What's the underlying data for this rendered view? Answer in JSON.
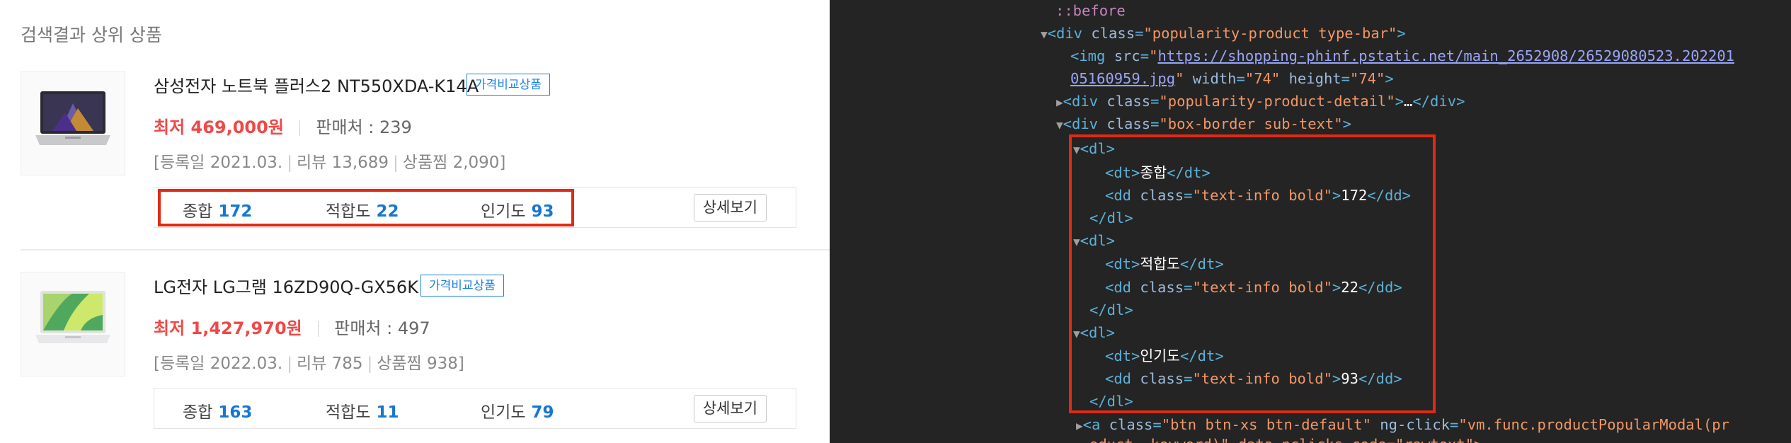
{
  "section_title": "검색결과 상위 상품",
  "products": [
    {
      "name": "삼성전자 노트북 플러스2 NT550XDA-K14A",
      "badge": "가격비교상품",
      "price": "최저 469,000원",
      "sellers": "판매처 : 239",
      "reg": "[등록일 2021.03.",
      "review": "리뷰 13,689",
      "wish": "상품찜 2,090]",
      "scores": [
        {
          "label": "종합",
          "value": "172"
        },
        {
          "label": "적합도",
          "value": "22"
        },
        {
          "label": "인기도",
          "value": "93"
        }
      ],
      "detail_btn": "상세보기",
      "thumb_icon": "laptop-image"
    },
    {
      "name": "LG전자 LG그램 16ZD90Q-GX56K",
      "badge": "가격비교상품",
      "price": "최저 1,427,970원",
      "sellers": "판매처 : 497",
      "reg": "[등록일 2022.03.",
      "review": "리뷰 785",
      "wish": "상품찜 938]",
      "scores": [
        {
          "label": "종합",
          "value": "163"
        },
        {
          "label": "적합도",
          "value": "11"
        },
        {
          "label": "인기도",
          "value": "79"
        }
      ],
      "detail_btn": "상세보기",
      "thumb_icon": "laptop-image"
    }
  ],
  "devtools": {
    "pseudo": "::before",
    "div1_class": "popularity-product type-bar",
    "img_src_1": "https://shopping-phinf.pstatic.net/main_2652908/26529080523.202201",
    "img_src_2": "05160959.jpg",
    "img_width": "74",
    "img_height": "74",
    "div2_class": "popularity-product-detail",
    "ellipsis": "…",
    "div3_class": "box-border sub-text",
    "dd_class": "text-info bold",
    "dt1": "종합",
    "dd1": "172",
    "dt2": "적합도",
    "dd2": "22",
    "dt3": "인기도",
    "dd3": "93",
    "a_class": "btn btn-xs btn-default",
    "a_click": "vm.func.productPopularModal(pr",
    "last_line": "oduct, keyword)\" data-nclicks-code=\"rawtext\">"
  },
  "colors": {
    "price": "#f04848",
    "score_value": "#1677d2",
    "badge": "#1b7fe0",
    "highlight": "#e02a14",
    "devtools_bg": "#242424"
  }
}
